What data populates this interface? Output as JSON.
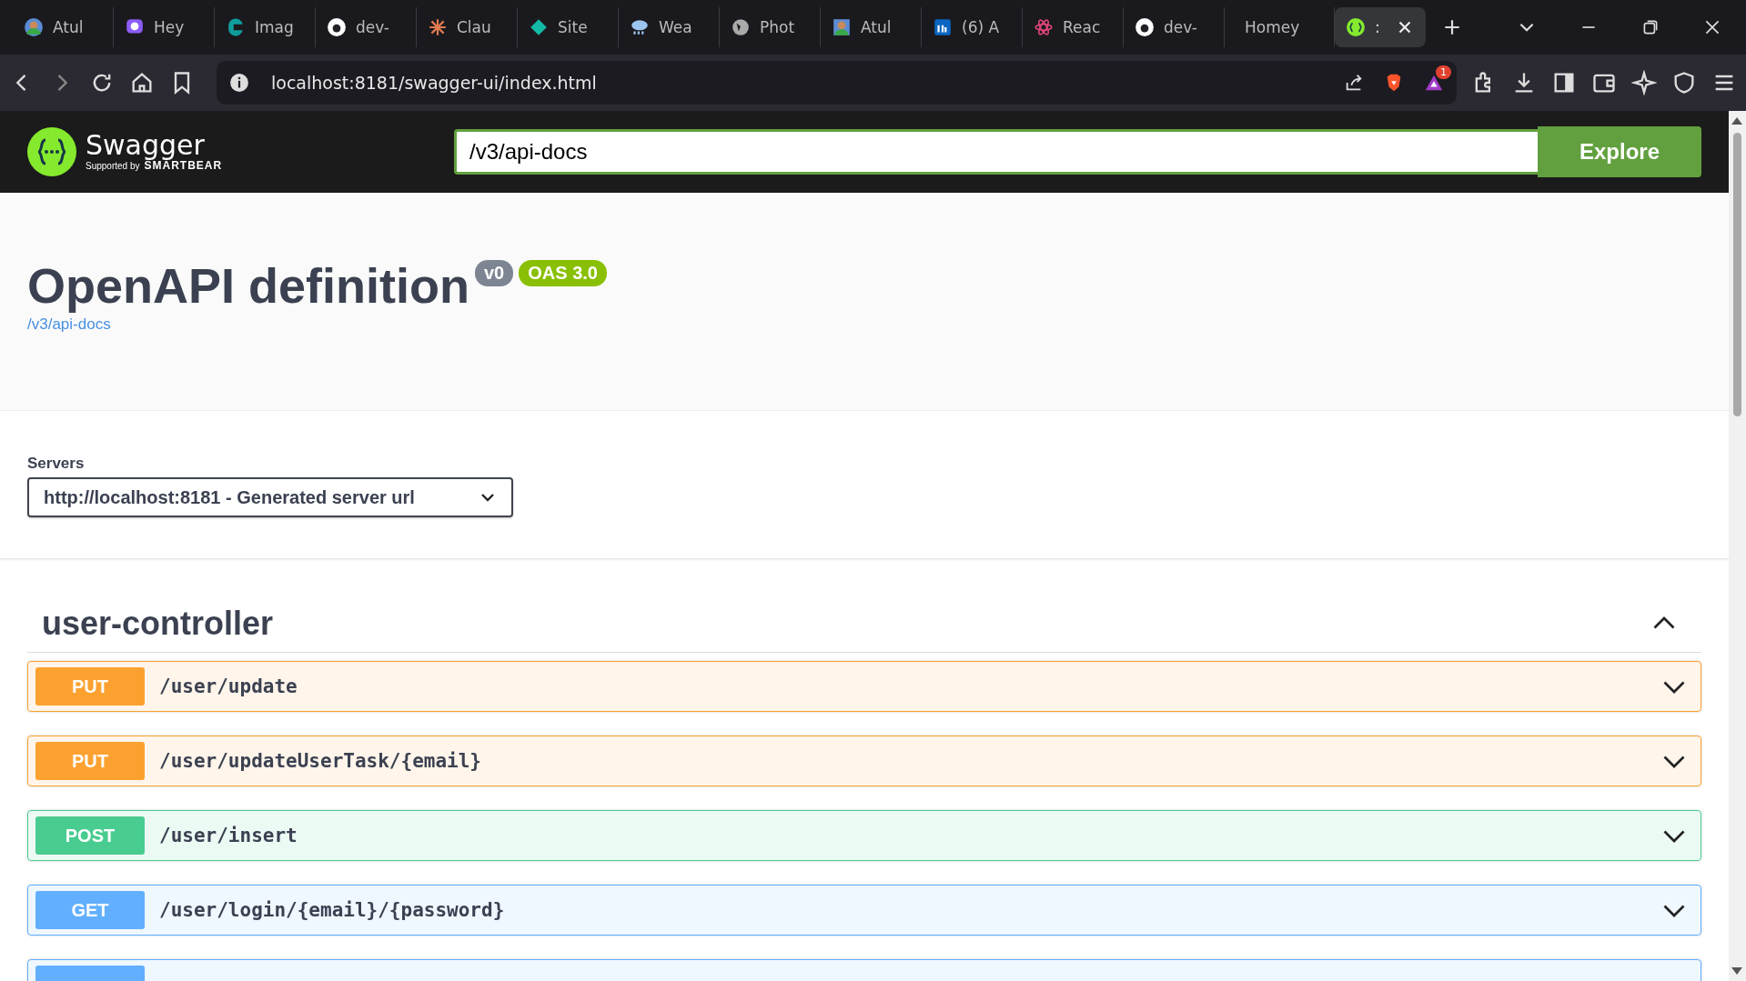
{
  "browser": {
    "tabs": [
      {
        "title": "Atul",
        "selected": false
      },
      {
        "title": "Hey",
        "selected": false
      },
      {
        "title": "Imag",
        "selected": false
      },
      {
        "title": "dev-",
        "selected": false
      },
      {
        "title": "Clau",
        "selected": false
      },
      {
        "title": "Site",
        "selected": false
      },
      {
        "title": "Wea",
        "selected": false
      },
      {
        "title": "Phot",
        "selected": false
      },
      {
        "title": "Atul",
        "selected": false
      },
      {
        "title": "(6) A",
        "selected": false
      },
      {
        "title": "Reac",
        "selected": false
      },
      {
        "title": "dev-",
        "selected": false
      },
      {
        "title": "Homey",
        "selected": false
      },
      {
        "title": ":",
        "selected": true
      }
    ],
    "url": "localhost:8181/swagger-ui/index.html",
    "notification_count": "1"
  },
  "topbar": {
    "logo_name": "Swagger",
    "logo_tagline": "Supported by",
    "logo_brand": "SMARTBEAR",
    "spec_url": "/v3/api-docs",
    "explore_button": "Explore"
  },
  "info": {
    "title": "OpenAPI definition",
    "version_badge": "v0",
    "oas_badge": "OAS 3.0",
    "spec_link": "/v3/api-docs"
  },
  "servers": {
    "label": "Servers",
    "selected_server": "http://localhost:8181 - Generated server url"
  },
  "tag": {
    "name": "user-controller",
    "expanded": true,
    "operations": [
      {
        "method": "PUT",
        "path": "/user/update",
        "cut_off": false
      },
      {
        "method": "PUT",
        "path": "/user/updateUserTask/{email}",
        "cut_off": false
      },
      {
        "method": "POST",
        "path": "/user/insert",
        "cut_off": false
      },
      {
        "method": "GET",
        "path": "/user/login/{email}/{password}",
        "cut_off": false
      },
      {
        "color": "#61affe",
        "cut_off": true
      }
    ]
  }
}
